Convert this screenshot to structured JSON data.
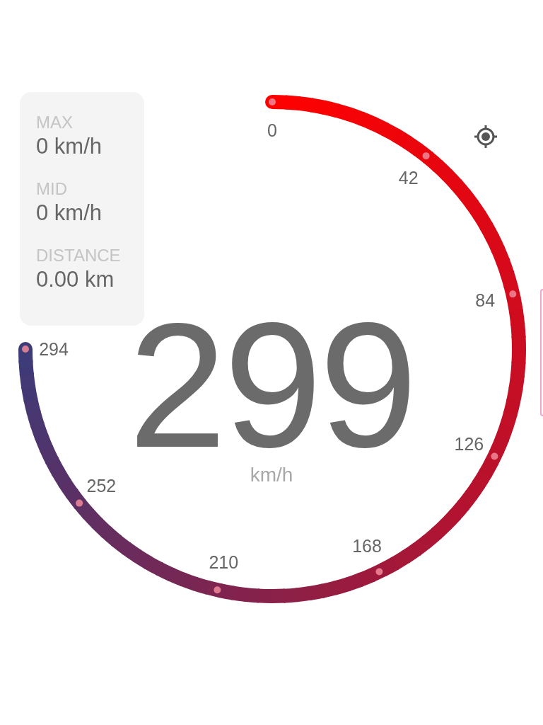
{
  "stats": [
    {
      "label": "MAX",
      "value": "0 km/h"
    },
    {
      "label": "MID",
      "value": "0 km/h"
    },
    {
      "label": "DISTANCE",
      "value": "0.00 km"
    }
  ],
  "gauge": {
    "ticks": [
      "0",
      "42",
      "84",
      "126",
      "168",
      "210",
      "252",
      "294"
    ],
    "speed": "299",
    "unit": "km/h"
  }
}
